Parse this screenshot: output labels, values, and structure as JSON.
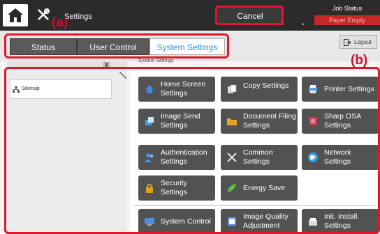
{
  "header": {
    "title": "Settings",
    "cancel_label": "Cancel",
    "job_status": "Job Status",
    "paper_status": "Paper Empty"
  },
  "annotations": {
    "a": "(a)",
    "b": "(b)"
  },
  "tabs": [
    {
      "label": "Status",
      "active": false
    },
    {
      "label": "User Control",
      "active": false
    },
    {
      "label": "System Settings",
      "active": true
    }
  ],
  "logout_label": "Logout",
  "breadcrumb": "System Settings",
  "sidebar": {
    "items": [
      {
        "label": "Sitemap",
        "icon": "sitemap-icon"
      }
    ]
  },
  "tiles": [
    {
      "label": "Home Screen Settings",
      "icon": "home-icon",
      "color": "#2f7fd0"
    },
    {
      "label": "Copy Settings",
      "icon": "copy-icon",
      "color": "#dddddd"
    },
    {
      "label": "Printer Settings",
      "icon": "printer-icon",
      "color": "#4a8fe0"
    },
    {
      "label": "Image Send Settings",
      "icon": "image-send-icon",
      "color": "#3aa0e0"
    },
    {
      "label": "Document Filing Settings",
      "icon": "folder-icon",
      "color": "#e0a020"
    },
    {
      "label": "Sharp OSA Settings",
      "icon": "osa-icon",
      "color": "#c04050"
    },
    {
      "label": "Authentication Settings",
      "icon": "users-icon",
      "color": "#3a80d0"
    },
    {
      "label": "Common Settings",
      "icon": "tools-icon",
      "color": "#cccccc"
    },
    {
      "label": "Network Settings",
      "icon": "globe-icon",
      "color": "#2fa0e0"
    },
    {
      "label": "Security Settings",
      "icon": "lock-icon",
      "color": "#e0a020"
    },
    {
      "label": "Energy Save",
      "icon": "leaf-icon",
      "color": "#60c040"
    },
    {
      "label": "System Control",
      "icon": "monitor-icon",
      "color": "#3a80d0"
    },
    {
      "label": "Image Quality Adjustment",
      "icon": "image-quality-icon",
      "color": "#5090e0"
    },
    {
      "label": "Init. Install. Settings",
      "icon": "install-icon",
      "color": "#dddddd"
    }
  ],
  "colors": {
    "accent_red": "#e3152b",
    "active_tab_text": "#2f8fd8",
    "tile_bg": "#525252",
    "status_red": "#c62828"
  }
}
